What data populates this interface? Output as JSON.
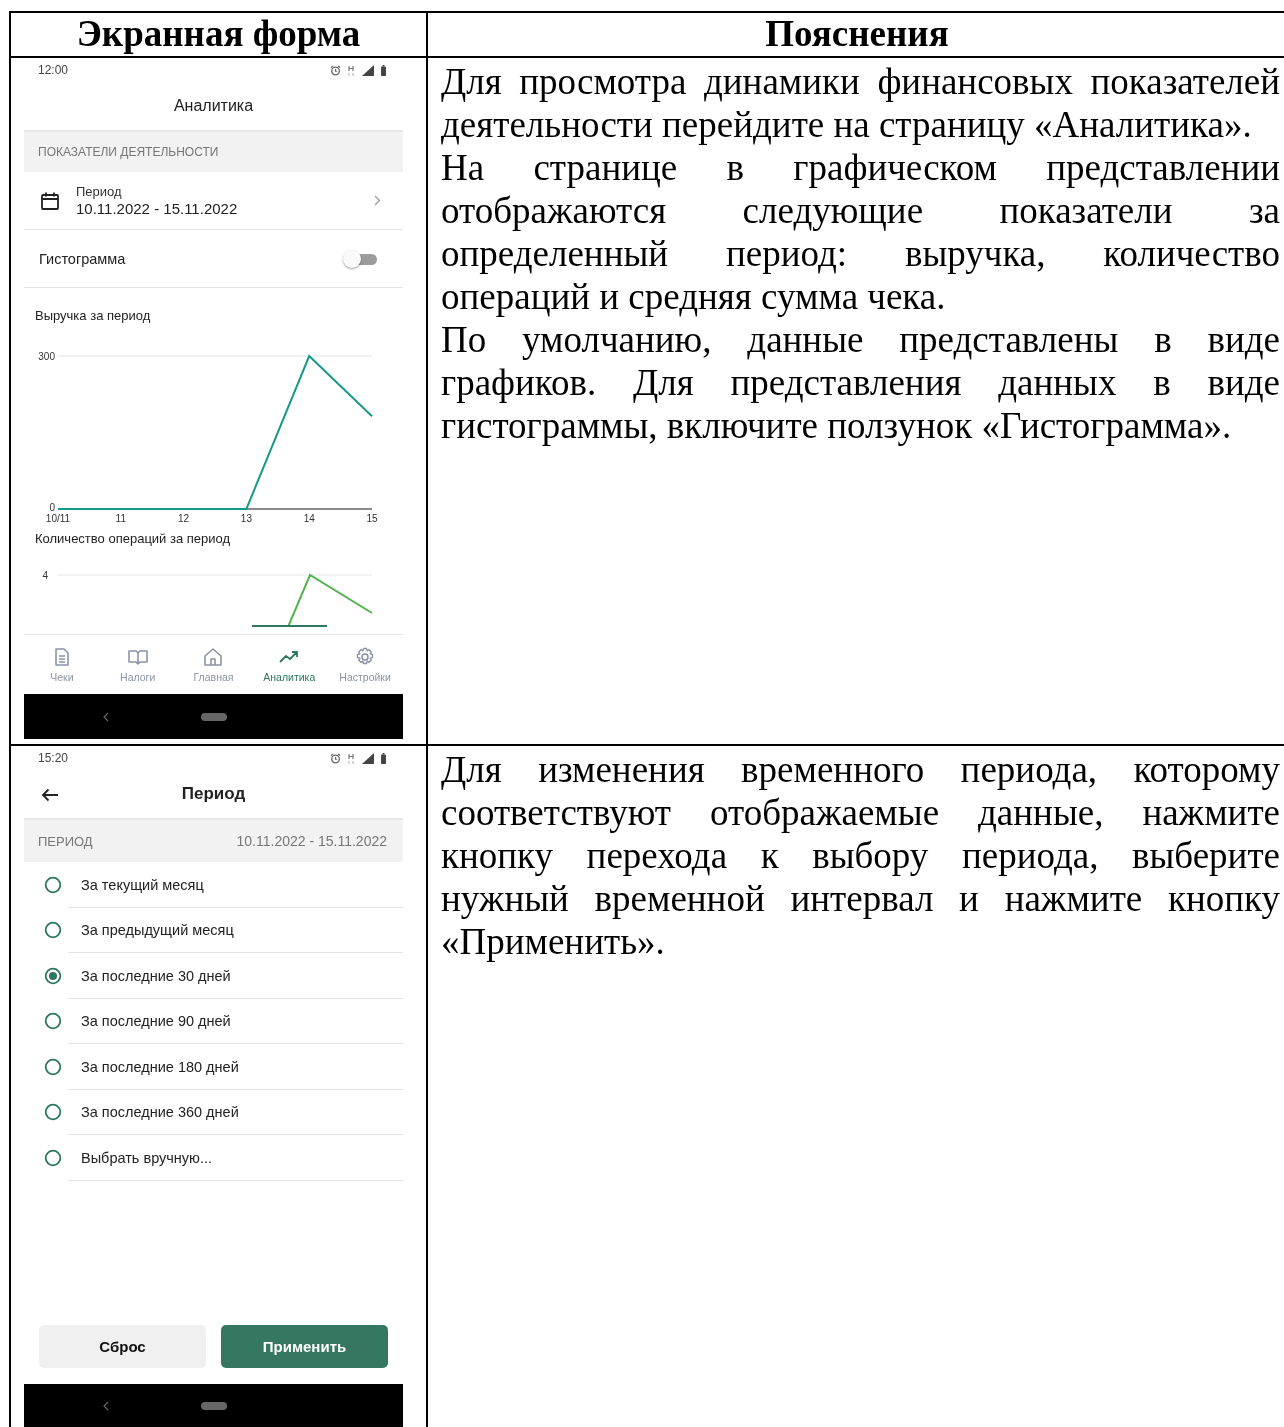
{
  "table": {
    "columns": [
      "Экранная форма",
      "Пояснения"
    ],
    "rows": [
      {
        "screen": {
          "kind": "analytics",
          "time": "12:00",
          "title": "Аналитика",
          "section": "ПОКАЗАТЕЛИ ДЕЯТЕЛЬНОСТИ",
          "period": {
            "label": "Период",
            "value": "10.11.2022 - 15.11.2022"
          },
          "toggle": {
            "label": "Гистограмма",
            "on": false
          },
          "charts": [
            {
              "title": "Выручка за период",
              "chart_data": {
                "type": "line",
                "categories": [
                  "10/11",
                  "11",
                  "12",
                  "13",
                  "14",
                  "15"
                ],
                "series": [
                  {
                    "color": "#17998a",
                    "values": [
                      0,
                      0,
                      0,
                      0,
                      300,
                      182
                    ]
                  }
                ],
                "yticks": [
                  0,
                  300
                ],
                "ylim": [
                  0,
                  300
                ]
              }
            },
            {
              "title": "Количество операций за период",
              "tick_label": "4"
            }
          ],
          "nav": [
            {
              "label": "Чеки",
              "selected": false
            },
            {
              "label": "Налоги",
              "selected": false
            },
            {
              "label": "Главная",
              "selected": false
            },
            {
              "label": "Аналитика",
              "selected": true
            },
            {
              "label": "Настройки",
              "selected": false
            }
          ]
        },
        "explanation": [
          "Для просмотра динамики финансовых показателей деятельности перейдите на страницу «Аналитика».",
          "На странице в графическом представлении отображаются следующие показатели за определенный период: выручка, количество операций и средняя сумма чека.",
          "По умолчанию, данные представлены в виде графиков. Для представления данных в виде гистограммы, включите ползунок «Гистограмма»."
        ]
      },
      {
        "screen": {
          "kind": "period",
          "time": "15:20",
          "title": "Период",
          "section": "ПЕРИОД",
          "section_value": "10.11.2022 - 15.11.2022",
          "options": [
            {
              "label": "За текущий месяц",
              "selected": false
            },
            {
              "label": "За предыдущий месяц",
              "selected": false
            },
            {
              "label": "За последние 30 дней",
              "selected": true
            },
            {
              "label": "За последние 90 дней",
              "selected": false
            },
            {
              "label": "За последние 180 дней",
              "selected": false
            },
            {
              "label": "За последние 360 дней",
              "selected": false
            },
            {
              "label": "Выбрать вручную...",
              "selected": false
            }
          ],
          "buttons": [
            {
              "label": "Сброс",
              "kind": "secondary"
            },
            {
              "label": "Применить",
              "kind": "primary"
            }
          ]
        },
        "explanation": [
          "Для изменения временного периода, которому соответствуют отображаемые данные, нажмите кнопку перехода к выбору периода, выберите нужный временной интервал и нажмите кнопку «Применить»."
        ]
      }
    ]
  }
}
